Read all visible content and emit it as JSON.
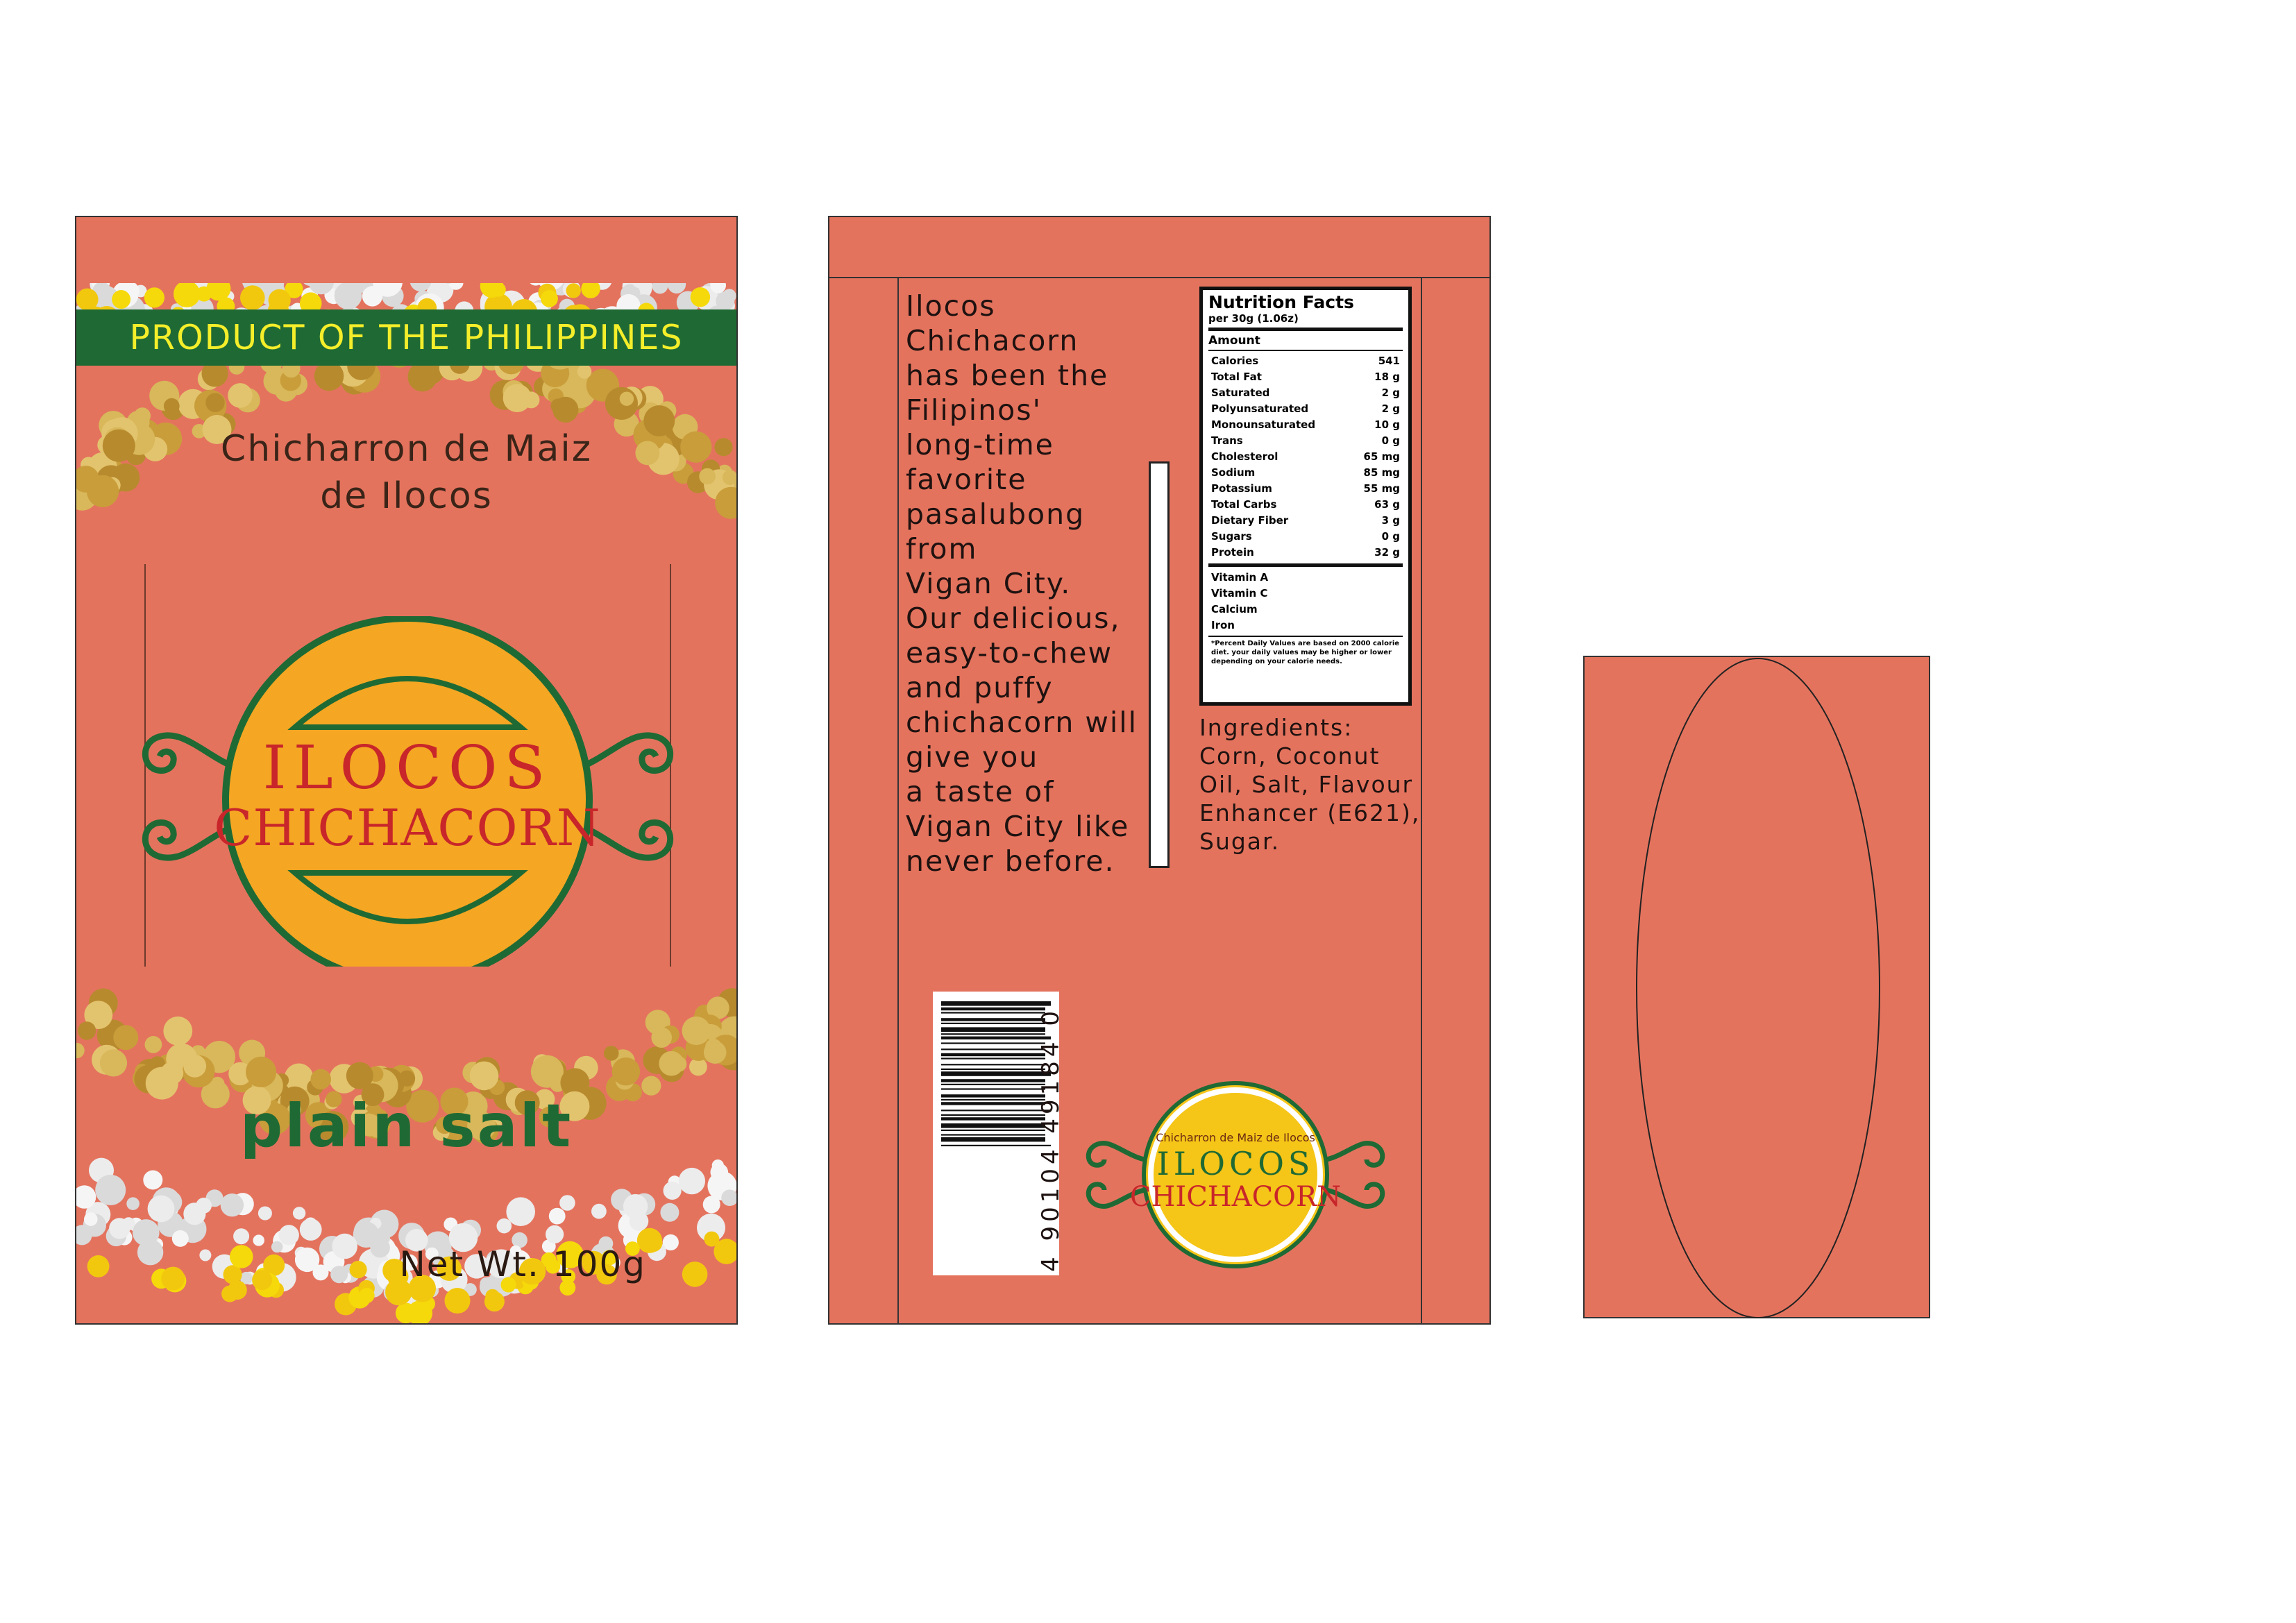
{
  "front": {
    "origin_label": "PRODUCT OF THE PHILIPPINES",
    "subtitle_line1": "Chicharron de Maiz",
    "subtitle_line2": "de Ilocos",
    "brand_line1": "ILOCOS",
    "brand_line2": "CHICHACORN",
    "flavor": "plain salt",
    "net_weight": "Net Wt. 100g"
  },
  "back": {
    "story": "Ilocos Chichacorn has been the Filipinos' long-time favorite pasalubong from Vigan City. Our delicious, easy-to-chew and puffy chichacorn will give you a taste of Vigan City like never before.",
    "story_lines": [
      "Ilocos",
      "Chichacorn",
      "has been the",
      "Filipinos'",
      "long-time",
      "favorite",
      "pasalubong",
      "from",
      "Vigan City.",
      "Our delicious,",
      "easy-to-chew",
      "and puffy",
      "chichacorn will",
      "give you",
      "a taste of",
      "Vigan City like",
      "never before."
    ],
    "nutrition": {
      "title": "Nutrition Facts",
      "serving": "per 30g (1.06z)",
      "amount_label": "Amount",
      "rows": [
        {
          "name": "Calories",
          "value": "541"
        },
        {
          "name": "Total Fat",
          "value": "18 g"
        },
        {
          "name": "Saturated",
          "value": "2 g"
        },
        {
          "name": "Polyunsaturated",
          "value": "2 g"
        },
        {
          "name": "Monounsaturated",
          "value": "10 g"
        },
        {
          "name": "Trans",
          "value": "0 g"
        },
        {
          "name": "Cholesterol",
          "value": "65 mg"
        },
        {
          "name": "Sodium",
          "value": "85 mg"
        },
        {
          "name": "Potassium",
          "value": "55 mg"
        },
        {
          "name": "Total Carbs",
          "value": "63 g"
        },
        {
          "name": "Dietary Fiber",
          "value": "3 g"
        },
        {
          "name": "Sugars",
          "value": "0 g"
        },
        {
          "name": "Protein",
          "value": "32 g"
        }
      ],
      "vitamins": [
        "Vitamin A",
        "Vitamin C",
        "Calcium",
        "Iron"
      ],
      "footnote": "*Percent Daily Values are based on 2000 calorie diet. your daily values may be higher or lower depending on your calorie needs."
    },
    "ingredients_lines": [
      "Ingredients:",
      "Corn, Coconut",
      "Oil, Salt, Flavour",
      "Enhancer (E621),",
      "Sugar."
    ],
    "barcode_number": "4 90104 49184 0",
    "mini_logo_top": "Chicharron de Maiz de Ilocos",
    "mini_logo_line1": "ILOCOS",
    "mini_logo_line2": "CHICHACORN"
  },
  "colors": {
    "panel": "#e4735e",
    "green": "#1f6a34",
    "orange": "#f5a623",
    "yellow": "#f5c518",
    "red": "#c8262a",
    "label_yellow": "#f5ee2a"
  },
  "icons": [
    "corn-texture-image",
    "salt-texture-image",
    "scroll-ornament-icon",
    "barcode-icon"
  ]
}
